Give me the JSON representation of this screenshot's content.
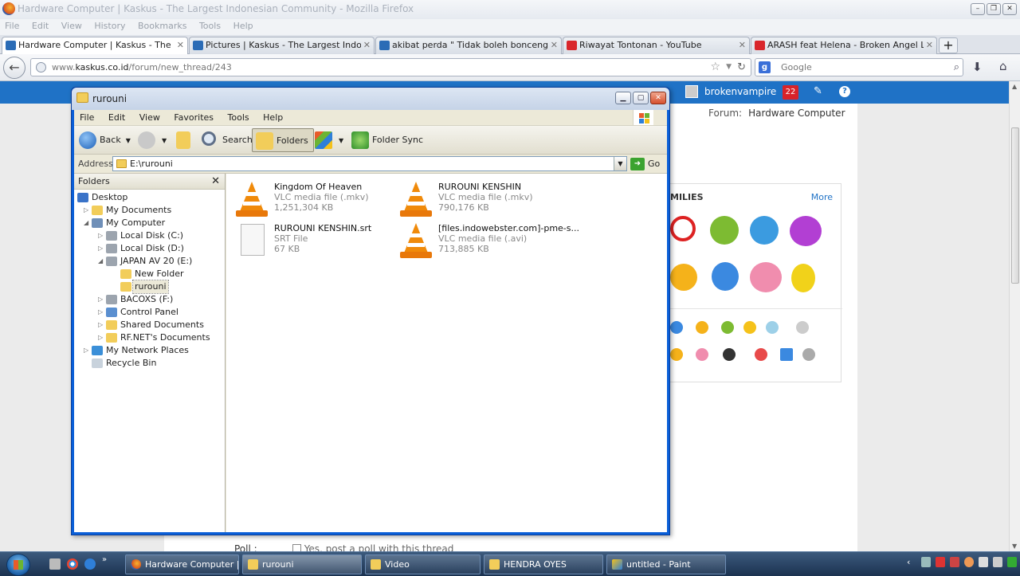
{
  "firefox": {
    "title": "Hardware Computer | Kaskus - The Largest Indonesian Community - Mozilla Firefox",
    "menu": [
      "File",
      "Edit",
      "View",
      "History",
      "Bookmarks",
      "Tools",
      "Help"
    ],
    "tabs": [
      {
        "label": "Hardware Computer | Kaskus - The Large...",
        "active": true,
        "favicon": "kaskus-icon"
      },
      {
        "label": "Pictures | Kaskus - The Largest Indonesia...",
        "active": false,
        "favicon": "kaskus-icon"
      },
      {
        "label": "akibat perda \" Tidak boleh bonceng ngan...",
        "active": false,
        "favicon": "kaskus-icon"
      },
      {
        "label": "Riwayat Tontonan - YouTube",
        "active": false,
        "favicon": "youtube-icon"
      },
      {
        "label": "ARASH feat Helena - Broken Angel Lyrics...",
        "active": false,
        "favicon": "youtube-icon"
      }
    ],
    "new_tab": "+",
    "url_prefix": "www.",
    "url_host": "kaskus.co.id",
    "url_path": "/forum/new_thread/243",
    "search_placeholder": "Google"
  },
  "kaskus": {
    "username": "brokenvampire",
    "notifications": "22",
    "help": "?",
    "forum_label": "Forum:",
    "forum_value": "Hardware Computer",
    "smilies_header": "MILIES",
    "smilies_more": "More",
    "poll_label": "Poll :",
    "poll_text": "Yes, post a poll with this thread"
  },
  "explorer": {
    "title": "rurouni",
    "menu": [
      "File",
      "Edit",
      "View",
      "Favorites",
      "Tools",
      "Help"
    ],
    "toolbar": {
      "back": "Back",
      "search": "Search",
      "folders": "Folders",
      "folder_sync": "Folder Sync"
    },
    "address_label": "Address",
    "address_value": "E:\\rurouni",
    "go_label": "Go",
    "folders_header": "Folders",
    "tree": [
      {
        "label": "Desktop",
        "level": 0,
        "icon": "desktop-icon",
        "toggle": ""
      },
      {
        "label": "My Documents",
        "level": 1,
        "icon": "documents-icon",
        "toggle": "▷"
      },
      {
        "label": "My Computer",
        "level": 1,
        "icon": "computer-icon",
        "toggle": "◢"
      },
      {
        "label": "Local Disk (C:)",
        "level": 2,
        "icon": "drive-icon",
        "toggle": "▷"
      },
      {
        "label": "Local Disk (D:)",
        "level": 2,
        "icon": "drive-icon",
        "toggle": "▷"
      },
      {
        "label": "JAPAN AV 20 (E:)",
        "level": 2,
        "icon": "drive-icon",
        "toggle": "◢"
      },
      {
        "label": "New Folder",
        "level": 3,
        "icon": "folder-icon",
        "toggle": ""
      },
      {
        "label": "rurouni",
        "level": 3,
        "icon": "folder-icon",
        "toggle": "",
        "selected": true
      },
      {
        "label": "BACOXS (F:)",
        "level": 2,
        "icon": "drive-icon",
        "toggle": "▷"
      },
      {
        "label": "Control Panel",
        "level": 2,
        "icon": "control-panel-icon",
        "toggle": "▷"
      },
      {
        "label": "Shared Documents",
        "level": 2,
        "icon": "folder-icon",
        "toggle": "▷"
      },
      {
        "label": "RF.NET's Documents",
        "level": 2,
        "icon": "folder-icon",
        "toggle": "▷"
      },
      {
        "label": "My Network Places",
        "level": 1,
        "icon": "network-icon",
        "toggle": "▷"
      },
      {
        "label": "Recycle Bin",
        "level": 1,
        "icon": "recycle-bin-icon",
        "toggle": ""
      }
    ],
    "files": [
      {
        "name": "Kingdom Of Heaven",
        "type": "VLC media file (.mkv)",
        "size": "1,251,304 KB",
        "icon": "vlc-icon"
      },
      {
        "name": "RUROUNI KENSHIN",
        "type": "VLC media file (.mkv)",
        "size": "790,176 KB",
        "icon": "vlc-icon"
      },
      {
        "name": "RUROUNI KENSHIN.srt",
        "type": "SRT File",
        "size": "67 KB",
        "icon": "document-icon"
      },
      {
        "name": "[files.indowebster.com]-pme-s...",
        "type": "VLC media file (.avi)",
        "size": "713,885 KB",
        "icon": "vlc-icon"
      }
    ]
  },
  "taskbar": {
    "items": [
      {
        "label": "Hardware Computer | ...",
        "icon": "firefox-icon",
        "active": false
      },
      {
        "label": "rurouni",
        "icon": "folder-icon",
        "active": true
      },
      {
        "label": "Video",
        "icon": "folder-icon",
        "active": false
      },
      {
        "label": "HENDRA OYES",
        "icon": "folder-icon",
        "active": false
      },
      {
        "label": "untitled - Paint",
        "icon": "paint-icon",
        "active": false
      }
    ]
  },
  "colors": {
    "kaskus_blue": "#1f72c6",
    "xp_blue": "#0a5fd8",
    "vlc_orange": "#f08a0a",
    "folder_yellow": "#f2cd5a"
  }
}
